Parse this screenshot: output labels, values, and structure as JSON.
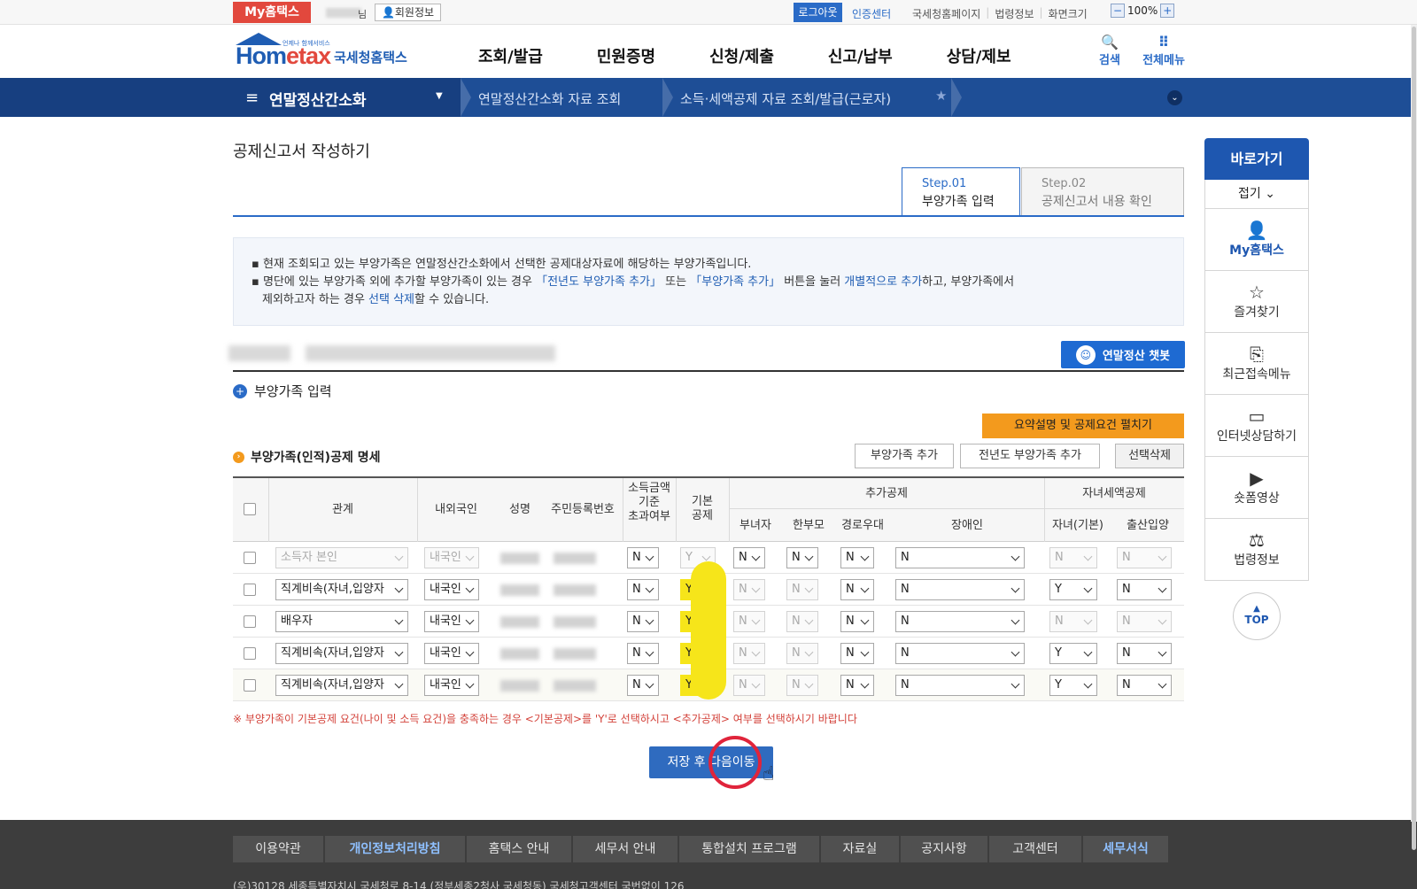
{
  "topbar": {
    "myhometax": "My홈택스",
    "user_suffix": "님",
    "member_info": "회원정보",
    "logout": "로그아웃",
    "cert_center": "인증센터",
    "links": [
      "국세청홈페이지",
      "법령정보",
      "화면크기"
    ],
    "zoom": "100%"
  },
  "header": {
    "logo_sub": "언제나 함께서비스",
    "logo_main_a": "Hom",
    "logo_main_b": "etax",
    "logo_kr": "국세청홈택스",
    "nav": [
      "조회/발급",
      "민원증명",
      "신청/제출",
      "신고/납부",
      "상담/제보"
    ],
    "search": "검색",
    "all_menu": "전체메뉴"
  },
  "breadcrumb": {
    "main": "연말정산간소화",
    "items": [
      "연말정산간소화 자료 조회",
      "소득·세액공제 자료 조회/발급(근로자)"
    ]
  },
  "page": {
    "title": "공제신고서 작성하기",
    "steps": [
      {
        "no": "Step.01",
        "name": "부양가족 입력"
      },
      {
        "no": "Step.02",
        "name": "공제신고서 내용 확인"
      }
    ],
    "info_line1": "현재 조회되고 있는 부양가족은 연말정산간소화에서 선택한 공제대상자료에 해당하는 부양가족입니다.",
    "info_line2_a": "명단에 있는 부양가족 외에 추가할 부양가족이 있는 경우 ",
    "info_line2_b": "「전년도 부양가족 추가」",
    "info_line2_c": " 또는 ",
    "info_line2_d": "「부양가족 추가」",
    "info_line2_e": " 버튼을 눌러 ",
    "info_line2_f": "개별적으로 추가",
    "info_line2_g": "하고, 부양가족에서",
    "info_line3_a": "제외하고자 하는 경우 ",
    "info_line3_b": "선택 삭제",
    "info_line3_c": "할 수 있습니다.",
    "chatbot": "연말정산 챗봇",
    "section_title": "부양가족 입력",
    "summary_btn": "요약설명 및 공제요건 펼치기",
    "sub_title": "부양가족(인적)공제 명세",
    "add_btn": "부양가족 추가",
    "prev_add_btn": "전년도 부양가족 추가",
    "delete_btn": "선택삭제",
    "note": "※  부양가족이 기본공제 요건(나이 및 소득 요건)을 충족하는 경우 <기본공제>를 'Y'로 선택하시고 <추가공제> 여부를 선택하시기 바랍니다",
    "save_btn": "저장 후 다음이동"
  },
  "table": {
    "headers": {
      "relation": "관계",
      "domestic": "내외국인",
      "name": "성명",
      "rrn": "주민등록번호",
      "income_over_1": "소득금액",
      "income_over_2": "기준",
      "income_over_3": "초과여부",
      "basic_1": "기본",
      "basic_2": "공제",
      "extra_group": "추가공제",
      "child_group": "자녀세액공제",
      "woman": "부녀자",
      "single_parent": "한부모",
      "elderly": "경로우대",
      "disabled": "장애인",
      "child_basic": "자녀(기본)",
      "birth_adopt": "출산입양"
    },
    "rows": [
      {
        "relation": "소득자 본인",
        "domestic": "내국인",
        "income_over": "N",
        "basic": "Y",
        "woman": "N",
        "single_parent": "N",
        "elderly": "N",
        "disabled": "N",
        "child": "N",
        "birth": "N"
      },
      {
        "relation": "직계비속(자녀,입양자",
        "domestic": "내국인",
        "income_over": "N",
        "basic": "Y",
        "woman": "N",
        "single_parent": "N",
        "elderly": "N",
        "disabled": "N",
        "child": "Y",
        "birth": "N"
      },
      {
        "relation": "배우자",
        "domestic": "내국인",
        "income_over": "N",
        "basic": "Y",
        "woman": "N",
        "single_parent": "N",
        "elderly": "N",
        "disabled": "N",
        "child": "N",
        "birth": "N"
      },
      {
        "relation": "직계비속(자녀,입양자",
        "domestic": "내국인",
        "income_over": "N",
        "basic": "Y",
        "woman": "N",
        "single_parent": "N",
        "elderly": "N",
        "disabled": "N",
        "child": "Y",
        "birth": "N"
      },
      {
        "relation": "직계비속(자녀,입양자",
        "domestic": "내국인",
        "income_over": "N",
        "basic": "Y",
        "woman": "N",
        "single_parent": "N",
        "elderly": "N",
        "disabled": "N",
        "child": "Y",
        "birth": "N"
      }
    ]
  },
  "quick": {
    "title": "바로가기",
    "fold": "접기",
    "items": [
      "My홈택스",
      "즐겨찾기",
      "최근접속메뉴",
      "인터넷상담하기",
      "숏폼영상",
      "법령정보"
    ],
    "top": "TOP"
  },
  "footer": {
    "links": [
      "이용약관",
      "개인정보처리방침",
      "홈택스 안내",
      "세무서 안내",
      "통합설치 프로그램",
      "자료실",
      "공지사항",
      "고객센터",
      "세무서식"
    ],
    "address": "(우)30128 세종특별자치시 국세청로 8-14 (정부세종2청사 국세청동) 국세청고객센터 국번없이 126"
  },
  "colors": {
    "accent": "#1e57b0",
    "highlight": "#f6e51a",
    "alert": "#e0243b",
    "orange": "#f39a1d"
  }
}
